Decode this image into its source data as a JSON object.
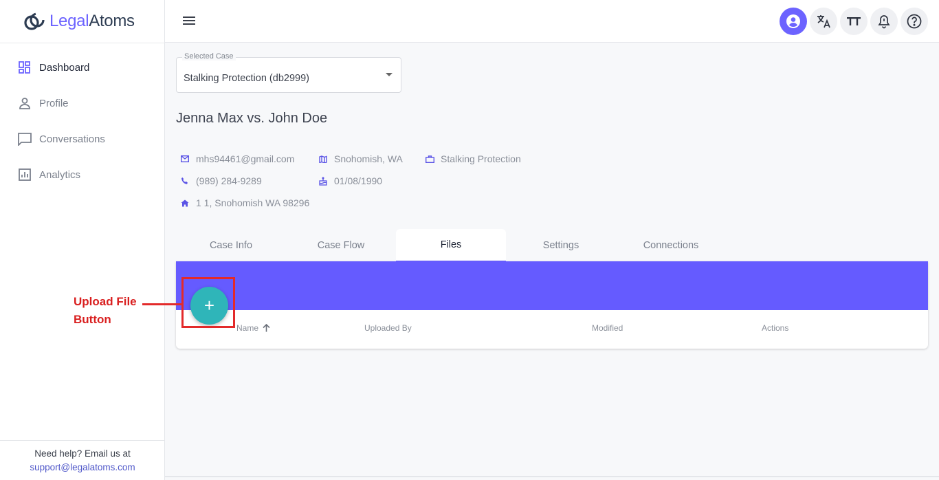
{
  "brand": {
    "part1": "Legal",
    "part2": "Atoms",
    "accent": "#6c63ff"
  },
  "sidebar": {
    "items": [
      {
        "label": "Dashboard",
        "icon": "dashboard-icon",
        "active": true
      },
      {
        "label": "Profile",
        "icon": "person-icon"
      },
      {
        "label": "Conversations",
        "icon": "chat-icon"
      },
      {
        "label": "Analytics",
        "icon": "analytics-icon"
      }
    ],
    "help_text": "Need help? Email us at",
    "help_email": "support@legalatoms.com"
  },
  "header": {
    "icons": [
      "account-icon",
      "translate-icon",
      "text-size-icon",
      "notification-icon",
      "help-icon"
    ]
  },
  "case_select": {
    "label": "Selected Case",
    "value": "Stalking Protection (db2999)"
  },
  "case": {
    "title": "Jenna Max vs. John Doe",
    "email": "mhs94461@gmail.com",
    "location": "Snohomish, WA",
    "case_type": "Stalking Protection",
    "phone": "(989) 284-9289",
    "dob": "01/08/1990",
    "address": "1 1, Snohomish WA 98296"
  },
  "tabs": [
    "Case Info",
    "Case Flow",
    "Files",
    "Settings",
    "Connections"
  ],
  "active_tab": "Files",
  "files_table": {
    "columns": [
      "Name",
      "Uploaded By",
      "Modified",
      "Actions"
    ],
    "sort_column": "Name",
    "sort_direction": "ascending"
  },
  "fab_symbol": "+",
  "annotation": {
    "line1": "Upload File",
    "line2": "Button",
    "color": "#e32a2a"
  }
}
